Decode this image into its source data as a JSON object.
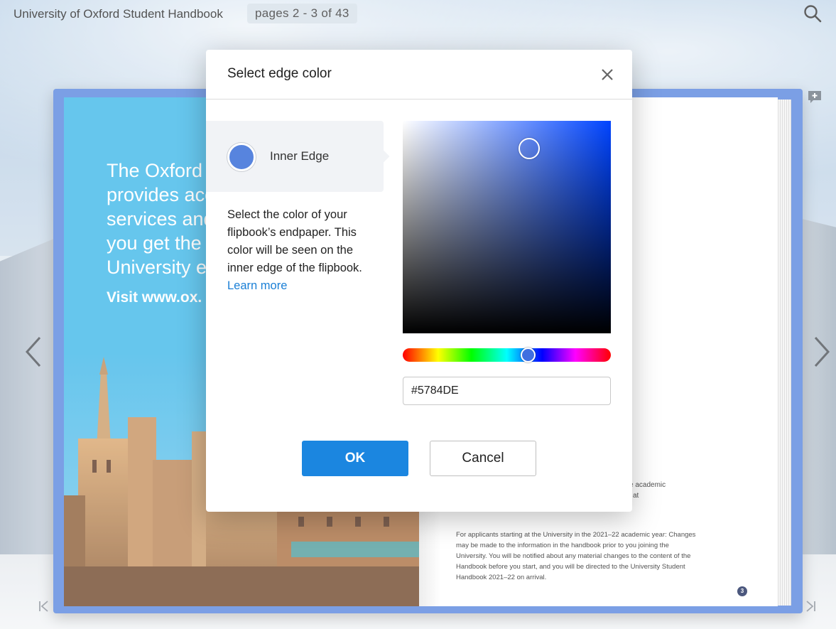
{
  "header": {
    "title": "University of Oxford Student Handbook",
    "page_indicator": "pages 2 - 3 of 43"
  },
  "book": {
    "left_page": {
      "headline": "The Oxford \nprovides acc\nservices and\nyou get the \nUniversity ex",
      "visit": "Visit www.ox."
    },
    "right_page": {
      "fragment": "e academic\nl at",
      "notice": "For applicants starting at the University in the 2021–22 academic year: Changes may be made to the information in the handbook prior to you joining the University. You will be notified about any material changes to the content of the Handbook before you start, and you will be directed to the University Student Handbook 2021–22 on arrival.",
      "page_number": "3"
    },
    "edge_color": "#5784DE"
  },
  "dialog": {
    "title": "Select edge color",
    "option_label": "Inner Edge",
    "description": "Select the color of your flipbook’s endpaper. This color will be seen on the inner edge of the flipbook.",
    "learn_more": "Learn more",
    "hex_value": "#5784DE",
    "ok_label": "OK",
    "cancel_label": "Cancel"
  },
  "icons": {
    "search": "search-icon",
    "close": "close-icon",
    "prev": "chevron-left-icon",
    "next": "chevron-right-icon",
    "first": "first-page-icon",
    "last": "last-page-icon",
    "note": "add-note-icon"
  },
  "colors": {
    "accent": "#1B86E0",
    "edge": "#5784DE",
    "link": "#1A7FD6"
  }
}
